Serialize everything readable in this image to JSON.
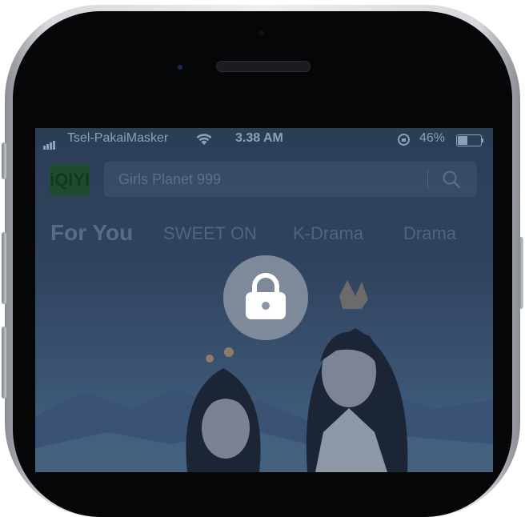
{
  "status_bar": {
    "carrier": "Tsel-PakaiMasker",
    "time": "3.38 AM",
    "battery": "46%",
    "battery_level": 0.46
  },
  "search": {
    "placeholder": "Girls Planet 999"
  },
  "logo": {
    "text": "iQIYI"
  },
  "tabs": [
    {
      "label": "For You",
      "active": true
    },
    {
      "label": "SWEET ON",
      "active": false
    },
    {
      "label": "K-Drama",
      "active": false
    },
    {
      "label": "Drama",
      "active": false
    }
  ],
  "overlay": {
    "icon": "lock-icon"
  },
  "colors": {
    "screen_tint": "#2c3d56",
    "lock_bg": "#8c96a5"
  }
}
